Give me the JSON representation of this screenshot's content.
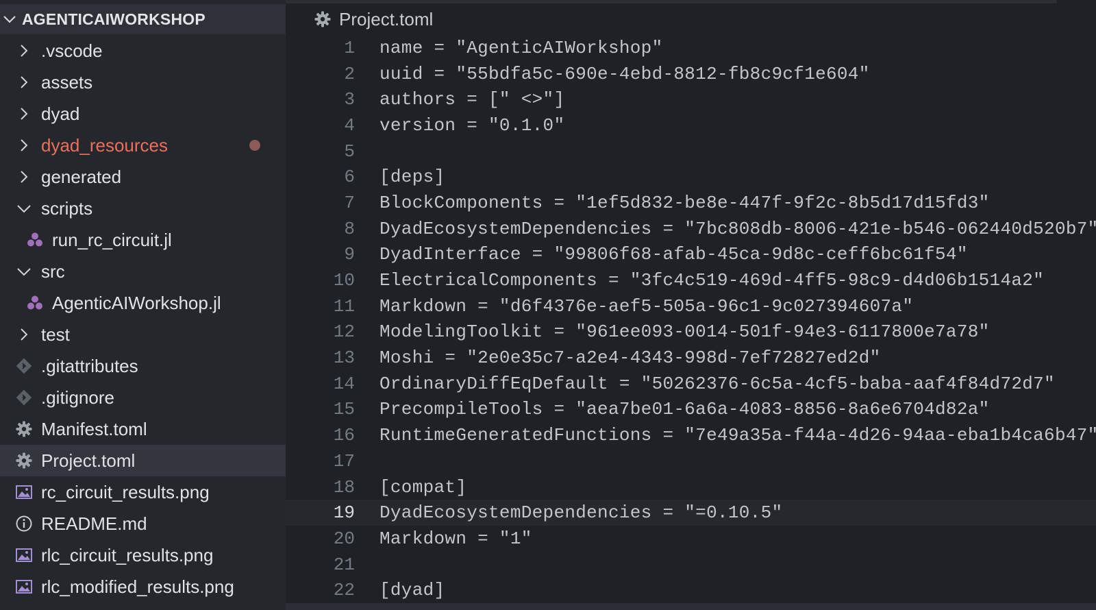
{
  "explorer": {
    "project_name": "AGENTICAIWORKSHOP",
    "items": [
      {
        "label": ".vscode",
        "kind": "folder-collapsed",
        "depth": 0,
        "icon": "chevron-right-icon"
      },
      {
        "label": "assets",
        "kind": "folder-collapsed",
        "depth": 0,
        "icon": "chevron-right-icon"
      },
      {
        "label": "dyad",
        "kind": "folder-collapsed",
        "depth": 0,
        "icon": "chevron-right-icon"
      },
      {
        "label": "dyad_resources",
        "kind": "folder-collapsed",
        "depth": 0,
        "icon": "chevron-right-icon",
        "modified": true
      },
      {
        "label": "generated",
        "kind": "folder-collapsed",
        "depth": 0,
        "icon": "chevron-right-icon"
      },
      {
        "label": "scripts",
        "kind": "folder-expanded",
        "depth": 0,
        "icon": "chevron-down-icon"
      },
      {
        "label": "run_rc_circuit.jl",
        "kind": "file",
        "depth": 1,
        "icon": "julia-file-icon"
      },
      {
        "label": "src",
        "kind": "folder-expanded",
        "depth": 0,
        "icon": "chevron-down-icon"
      },
      {
        "label": "AgenticAIWorkshop.jl",
        "kind": "file",
        "depth": 1,
        "icon": "julia-file-icon"
      },
      {
        "label": "test",
        "kind": "folder-collapsed",
        "depth": 0,
        "icon": "chevron-right-icon"
      },
      {
        "label": ".gitattributes",
        "kind": "file",
        "depth": 0,
        "icon": "git-file-icon"
      },
      {
        "label": ".gitignore",
        "kind": "file",
        "depth": 0,
        "icon": "git-file-icon"
      },
      {
        "label": "Manifest.toml",
        "kind": "file",
        "depth": 0,
        "icon": "gear-file-icon"
      },
      {
        "label": "Project.toml",
        "kind": "file",
        "depth": 0,
        "icon": "gear-file-icon",
        "selected": true
      },
      {
        "label": "rc_circuit_results.png",
        "kind": "file",
        "depth": 0,
        "icon": "image-file-icon"
      },
      {
        "label": "README.md",
        "kind": "file",
        "depth": 0,
        "icon": "info-file-icon"
      },
      {
        "label": "rlc_circuit_results.png",
        "kind": "file",
        "depth": 0,
        "icon": "image-file-icon"
      },
      {
        "label": "rlc_modified_results.png",
        "kind": "file",
        "depth": 0,
        "icon": "image-file-icon"
      }
    ]
  },
  "editor": {
    "breadcrumb": "Project.toml",
    "current_line": 19,
    "lines": [
      {
        "n": "1",
        "text": "name = \"AgenticAIWorkshop\""
      },
      {
        "n": "2",
        "text": "uuid = \"55bdfa5c-690e-4ebd-8812-fb8c9cf1e604\""
      },
      {
        "n": "3",
        "text": "authors = [\" <>\"]"
      },
      {
        "n": "4",
        "text": "version = \"0.1.0\""
      },
      {
        "n": "5",
        "text": ""
      },
      {
        "n": "6",
        "text": "[deps]"
      },
      {
        "n": "7",
        "text": "BlockComponents = \"1ef5d832-be8e-447f-9f2c-8b5d17d15fd3\""
      },
      {
        "n": "8",
        "text": "DyadEcosystemDependencies = \"7bc808db-8006-421e-b546-062440d520b7\""
      },
      {
        "n": "9",
        "text": "DyadInterface = \"99806f68-afab-45ca-9d8c-ceff6bc61f54\""
      },
      {
        "n": "10",
        "text": "ElectricalComponents = \"3fc4c519-469d-4ff5-98c9-d4d06b1514a2\""
      },
      {
        "n": "11",
        "text": "Markdown = \"d6f4376e-aef5-505a-96c1-9c027394607a\""
      },
      {
        "n": "12",
        "text": "ModelingToolkit = \"961ee093-0014-501f-94e3-6117800e7a78\""
      },
      {
        "n": "13",
        "text": "Moshi = \"2e0e35c7-a2e4-4343-998d-7ef72827ed2d\""
      },
      {
        "n": "14",
        "text": "OrdinaryDiffEqDefault = \"50262376-6c5a-4cf5-baba-aaf4f84d72d7\""
      },
      {
        "n": "15",
        "text": "PrecompileTools = \"aea7be01-6a6a-4083-8856-8a6e6704d82a\""
      },
      {
        "n": "16",
        "text": "RuntimeGeneratedFunctions = \"7e49a35a-f44a-4d26-94aa-eba1b4ca6b47\""
      },
      {
        "n": "17",
        "text": ""
      },
      {
        "n": "18",
        "text": "[compat]"
      },
      {
        "n": "19",
        "text": "DyadEcosystemDependencies = \"=0.10.5\""
      },
      {
        "n": "20",
        "text": "Markdown = \"1\""
      },
      {
        "n": "21",
        "text": ""
      },
      {
        "n": "22",
        "text": "[dyad]"
      }
    ]
  },
  "colors": {
    "sidebar_bg": "#24272c",
    "editor_bg": "#1e2125",
    "modified_text": "#ee6d5c",
    "julia_icon": "#a270ba",
    "image_icon": "#a48fd6"
  }
}
